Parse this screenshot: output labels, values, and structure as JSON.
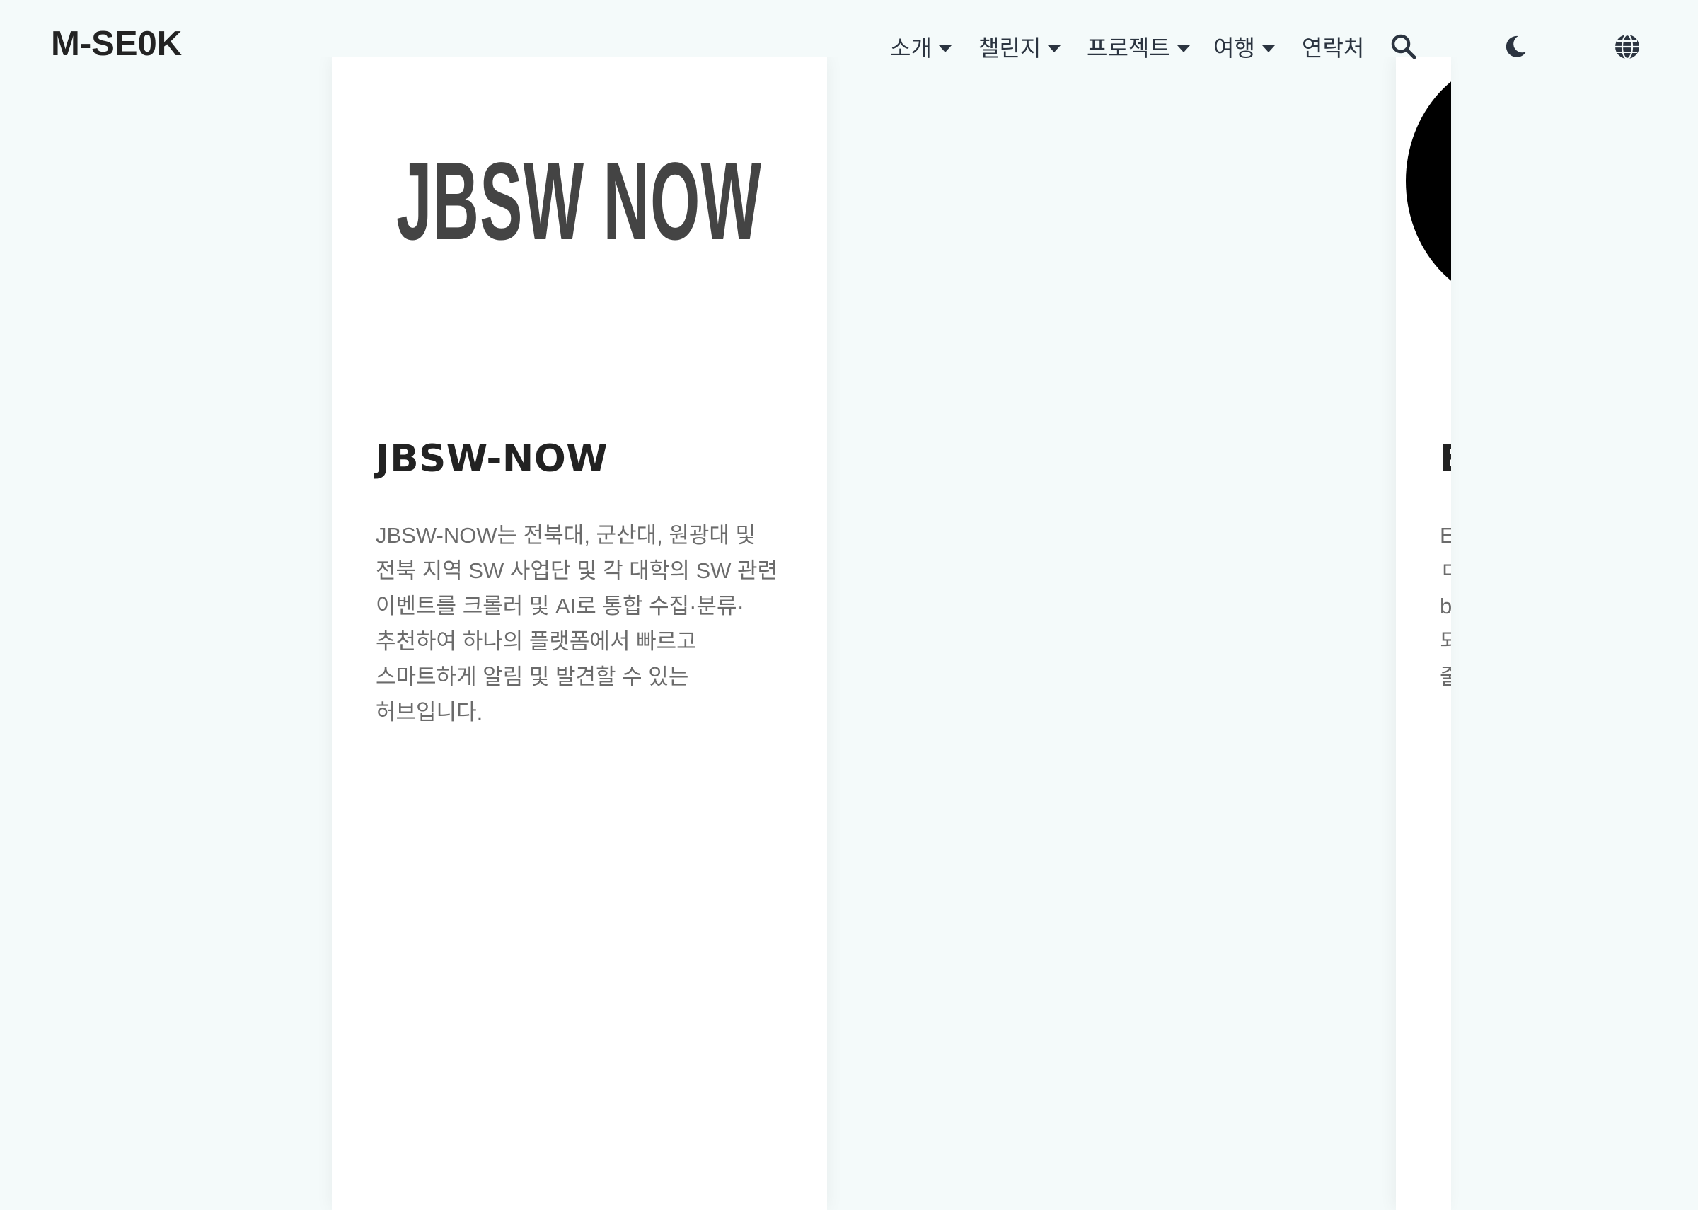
{
  "header": {
    "brand": "M-SE0K",
    "nav": [
      {
        "label": "소개",
        "dropdown": true
      },
      {
        "label": "챌린지",
        "dropdown": true
      },
      {
        "label": "프로젝트",
        "dropdown": true
      },
      {
        "label": "여행",
        "dropdown": true
      },
      {
        "label": "연락처",
        "dropdown": false
      }
    ],
    "icons": {
      "search": "search-icon",
      "theme": "moon-icon",
      "language": "globe-icon"
    }
  },
  "cards": [
    {
      "logo_text": "JBSW NOW",
      "title": "JBSW-NOW",
      "description": "JBSW-NOW는 전북대, 군산대, 원광대 및 전북 지역 SW 사업단 및 각 대학의 SW 관련 이벤트를 크롤러 및 AI로 통합 수집·분류·추천하여 하나의 플랫폼에서 빠르고 스마트하게 알림 및 발견할 수 있는 허브입니다."
    },
    {
      "title_partial": "E",
      "lines_partial": [
        "E",
        "ㄷ",
        "b",
        "되",
        "줄"
      ]
    }
  ],
  "colors": {
    "background": "#f4fafa",
    "card": "#ffffff",
    "text_dark": "#222222",
    "text_muted": "#6b6b6b",
    "nav_text": "#2b3440"
  }
}
